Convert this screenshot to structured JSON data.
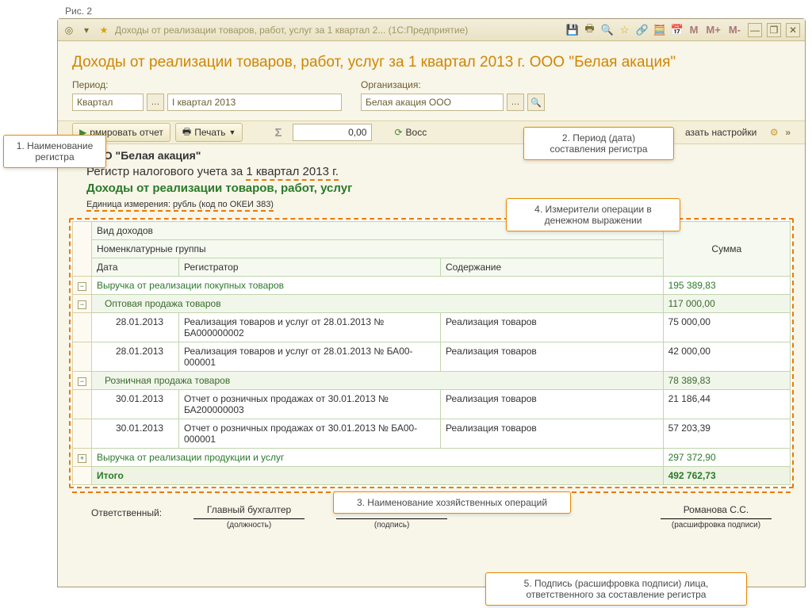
{
  "fig_caption": "Рис. 2",
  "titlebar": {
    "title": "Доходы от реализации товаров, работ, услуг за 1 квартал 2...   (1С:Предприятие)"
  },
  "winbuttons": {
    "min": "—",
    "restore": "❐",
    "close": "✕"
  },
  "mem": {
    "m": "M",
    "mplus": "M+",
    "mminus": "M-"
  },
  "report_title": "Доходы от реализации товаров, работ, услуг за 1 квартал 2013 г. ООО \"Белая акация\"",
  "filters": {
    "period_label": "Период:",
    "period_type": "Квартал",
    "period_value": "I квартал 2013",
    "org_label": "Организация:",
    "org_value": "Белая акация ООО"
  },
  "toolbar": {
    "form_report": "рмировать отчет",
    "print": "Печать",
    "sigma": "Σ",
    "num": "0,00",
    "restore": "Восс",
    "show_settings": "азать настройки",
    "expand": "»"
  },
  "header": {
    "org": "ООО \"Белая акация\"",
    "line2_a": "Регистр налогового учета за",
    "line2_b": "1 квартал 2013 г.",
    "line3": "Доходы от реализации товаров, работ, услуг",
    "unit_line": "Единица измерения:   рубль (код по ОКЕИ 383)"
  },
  "grid": {
    "h_vid": "Вид доходов",
    "h_nomgrp": "Номенклатурные группы",
    "h_date": "Дата",
    "h_reg": "Регистратор",
    "h_content": "Содержание",
    "h_sum": "Сумма",
    "grp1": {
      "name": "Выручка от реализации покупных товаров",
      "sum": "195 389,83"
    },
    "sub1": {
      "name": "Оптовая продажа товаров",
      "sum": "117 000,00"
    },
    "r1": {
      "date": "28.01.2013",
      "reg": "Реализация товаров и услуг от 28.01.2013 № БА000000002",
      "cont": "Реализация товаров",
      "sum": "75 000,00"
    },
    "r2": {
      "date": "28.01.2013",
      "reg": "Реализация товаров и услуг от 28.01.2013 № БА00-000001",
      "cont": "Реализация товаров",
      "sum": "42 000,00"
    },
    "sub2": {
      "name": "Розничная продажа товаров",
      "sum": "78 389,83"
    },
    "r3": {
      "date": "30.01.2013",
      "reg": "Отчет о розничных продажах от 30.01.2013 № БА200000003",
      "cont": "Реализация товаров",
      "sum": "21 186,44"
    },
    "r4": {
      "date": "30.01.2013",
      "reg": "Отчет о розничных продажах от 30.01.2013 № БА00-000001",
      "cont": "Реализация товаров",
      "sum": "57 203,39"
    },
    "grp2": {
      "name": "Выручка от реализации продукции и услуг",
      "sum": "297 372,90"
    },
    "total": {
      "name": "Итого",
      "sum": "492 762,73"
    }
  },
  "sign": {
    "resp": "Ответственный:",
    "position_value": "Главный бухгалтер",
    "position": "(должность)",
    "signature": "(подпись)",
    "name_value": "Романова С.С.",
    "name": "(расшифровка подписи)"
  },
  "callouts": {
    "c1": "1. Наименование регистра",
    "c2a": "2. Период (дата)",
    "c2b": "составления регистра",
    "c3": "3. Наименование хозяйственных операций",
    "c4a": "4. Измерители операции в",
    "c4b": "денежном выражении",
    "c5a": "5. Подпись (расшифровка подписи) лица,",
    "c5b": "ответственного за составление регистра"
  }
}
